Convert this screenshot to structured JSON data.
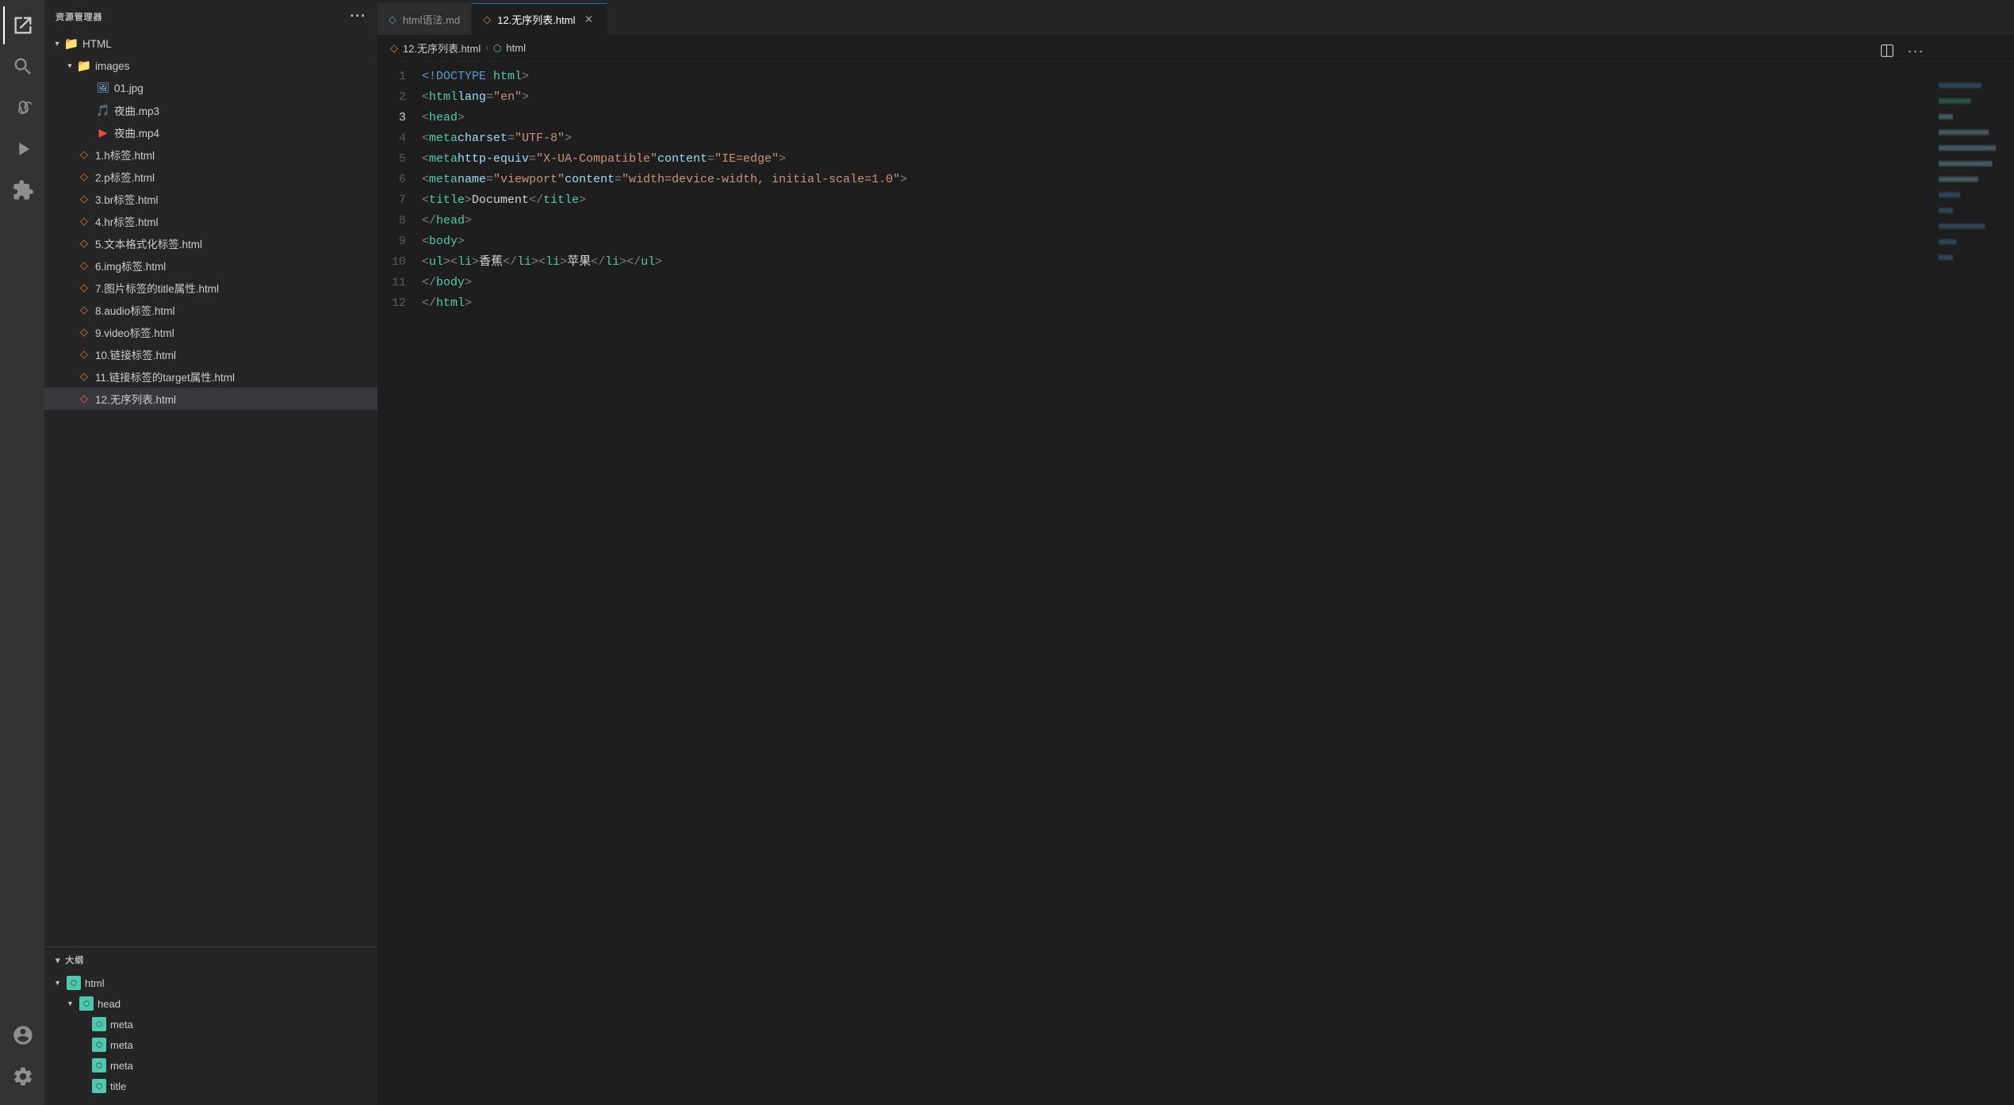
{
  "app": {
    "title": "资源管理器"
  },
  "tabs": [
    {
      "id": "tab-md",
      "icon": "◇",
      "icon_color": "#519aba",
      "label": "html语法.md",
      "active": false,
      "closable": false
    },
    {
      "id": "tab-html",
      "icon": "◇",
      "icon_color": "#e37933",
      "label": "12.无序列表.html",
      "active": true,
      "closable": true
    }
  ],
  "breadcrumb": {
    "parts": [
      "12.无序列表.html",
      ">",
      "html"
    ]
  },
  "sidebar": {
    "explorer_label": "资源管理器",
    "root_folder": "HTML",
    "tree": [
      {
        "id": "images",
        "type": "folder",
        "label": "images",
        "level": 1,
        "expanded": true
      },
      {
        "id": "01jpg",
        "type": "image",
        "label": "01.jpg",
        "level": 2
      },
      {
        "id": "yecmp3",
        "type": "audio",
        "label": "夜曲.mp3",
        "level": 2
      },
      {
        "id": "yecmp4",
        "type": "video",
        "label": "夜曲.mp4",
        "level": 2
      },
      {
        "id": "f1",
        "type": "html",
        "label": "1.h标签.html",
        "level": 1
      },
      {
        "id": "f2",
        "type": "html",
        "label": "2.p标签.html",
        "level": 1
      },
      {
        "id": "f3",
        "type": "html",
        "label": "3.br标签.html",
        "level": 1
      },
      {
        "id": "f4",
        "type": "html",
        "label": "4.hr标签.html",
        "level": 1
      },
      {
        "id": "f5",
        "type": "html",
        "label": "5.文本格式化标签.html",
        "level": 1
      },
      {
        "id": "f6",
        "type": "html",
        "label": "6.img标签.html",
        "level": 1
      },
      {
        "id": "f7",
        "type": "html",
        "label": "7.图片标签的title属性.html",
        "level": 1
      },
      {
        "id": "f8",
        "type": "html",
        "label": "8.audio标签.html",
        "level": 1
      },
      {
        "id": "f9",
        "type": "html",
        "label": "9.video标签.html",
        "level": 1
      },
      {
        "id": "f10",
        "type": "html",
        "label": "10.链接标签.html",
        "level": 1
      },
      {
        "id": "f11",
        "type": "html",
        "label": "11.链接标签的target属性.html",
        "level": 1
      },
      {
        "id": "f12",
        "type": "html",
        "label": "12.无序列表.html",
        "level": 1,
        "active": true
      }
    ]
  },
  "outline": {
    "label": "大纲",
    "items": [
      {
        "id": "o-html",
        "label": "html",
        "level": 0,
        "expanded": true
      },
      {
        "id": "o-head",
        "label": "head",
        "level": 1,
        "expanded": true
      },
      {
        "id": "o-meta1",
        "label": "meta",
        "level": 2
      },
      {
        "id": "o-meta2",
        "label": "meta",
        "level": 2
      },
      {
        "id": "o-meta3",
        "label": "meta",
        "level": 2
      },
      {
        "id": "o-title",
        "label": "title",
        "level": 2
      }
    ]
  },
  "editor": {
    "filename": "12.无序列表.html",
    "lines": [
      {
        "num": 1,
        "tokens": [
          {
            "t": "<!DOCTYPE ",
            "c": "doctype-kw"
          },
          {
            "t": "html",
            "c": "tag-name"
          },
          {
            "t": ">",
            "c": "punct"
          }
        ]
      },
      {
        "num": 2,
        "tokens": [
          {
            "t": "<",
            "c": "punct"
          },
          {
            "t": "html",
            "c": "tag-name"
          },
          {
            "t": " ",
            "c": ""
          },
          {
            "t": "lang",
            "c": "attr-name"
          },
          {
            "t": "=",
            "c": "punct"
          },
          {
            "t": "\"en\"",
            "c": "attr-val"
          },
          {
            "t": ">",
            "c": "punct"
          }
        ]
      },
      {
        "num": 3,
        "tokens": [
          {
            "t": "<",
            "c": "punct"
          },
          {
            "t": "head",
            "c": "tag-name"
          },
          {
            "t": ">",
            "c": "punct"
          }
        ],
        "active": false
      },
      {
        "num": 4,
        "tokens": [
          {
            "t": "    ",
            "c": ""
          },
          {
            "t": "<",
            "c": "punct"
          },
          {
            "t": "meta",
            "c": "tag-name"
          },
          {
            "t": " ",
            "c": ""
          },
          {
            "t": "charset",
            "c": "attr-name"
          },
          {
            "t": "=",
            "c": "punct"
          },
          {
            "t": "\"UTF-8\"",
            "c": "attr-val"
          },
          {
            "t": ">",
            "c": "punct"
          }
        ]
      },
      {
        "num": 5,
        "tokens": [
          {
            "t": "    ",
            "c": ""
          },
          {
            "t": "<",
            "c": "punct"
          },
          {
            "t": "meta",
            "c": "tag-name"
          },
          {
            "t": " ",
            "c": ""
          },
          {
            "t": "http-equiv",
            "c": "attr-name"
          },
          {
            "t": "=",
            "c": "punct"
          },
          {
            "t": "\"X-UA-Compatible\"",
            "c": "attr-val"
          },
          {
            "t": " ",
            "c": ""
          },
          {
            "t": "content",
            "c": "attr-name"
          },
          {
            "t": "=",
            "c": "punct"
          },
          {
            "t": "\"IE=edge\"",
            "c": "attr-val"
          },
          {
            "t": ">",
            "c": "punct"
          }
        ]
      },
      {
        "num": 6,
        "tokens": [
          {
            "t": "    ",
            "c": ""
          },
          {
            "t": "<",
            "c": "punct"
          },
          {
            "t": "meta",
            "c": "tag-name"
          },
          {
            "t": " ",
            "c": ""
          },
          {
            "t": "name",
            "c": "attr-name"
          },
          {
            "t": "=",
            "c": "punct"
          },
          {
            "t": "\"viewport\"",
            "c": "attr-val"
          },
          {
            "t": " ",
            "c": ""
          },
          {
            "t": "content",
            "c": "attr-name"
          },
          {
            "t": "=",
            "c": "punct"
          },
          {
            "t": "\"width=device-width, initial-scale=1.0\"",
            "c": "attr-val"
          },
          {
            "t": ">",
            "c": "punct"
          }
        ]
      },
      {
        "num": 7,
        "tokens": [
          {
            "t": "    ",
            "c": ""
          },
          {
            "t": "<",
            "c": "punct"
          },
          {
            "t": "title",
            "c": "tag-name"
          },
          {
            "t": ">",
            "c": "punct"
          },
          {
            "t": "Document",
            "c": "text-content"
          },
          {
            "t": "</",
            "c": "punct"
          },
          {
            "t": "title",
            "c": "tag-name"
          },
          {
            "t": ">",
            "c": "punct"
          }
        ]
      },
      {
        "num": 8,
        "tokens": [
          {
            "t": "</",
            "c": "punct"
          },
          {
            "t": "head",
            "c": "tag-name"
          },
          {
            "t": ">",
            "c": "punct"
          }
        ]
      },
      {
        "num": 9,
        "tokens": [
          {
            "t": "<",
            "c": "punct"
          },
          {
            "t": "body",
            "c": "tag-name"
          },
          {
            "t": ">",
            "c": "punct"
          }
        ]
      },
      {
        "num": 10,
        "tokens": [
          {
            "t": "    ",
            "c": ""
          },
          {
            "t": "<",
            "c": "punct"
          },
          {
            "t": "ul",
            "c": "tag-name"
          },
          {
            "t": ">",
            "c": "punct"
          },
          {
            "t": "<",
            "c": "punct"
          },
          {
            "t": "li",
            "c": "tag-name"
          },
          {
            "t": ">",
            "c": "punct"
          },
          {
            "t": "香蕉",
            "c": "text-content"
          },
          {
            "t": "</",
            "c": "punct"
          },
          {
            "t": "li",
            "c": "tag-name"
          },
          {
            "t": ">",
            "c": "punct"
          },
          {
            "t": "<",
            "c": "punct"
          },
          {
            "t": "li",
            "c": "tag-name"
          },
          {
            "t": ">",
            "c": "punct"
          },
          {
            "t": "苹果",
            "c": "text-content"
          },
          {
            "t": "</",
            "c": "punct"
          },
          {
            "t": "li",
            "c": "tag-name"
          },
          {
            "t": ">",
            "c": "punct"
          },
          {
            "t": "</",
            "c": "punct"
          },
          {
            "t": "ul",
            "c": "tag-name"
          },
          {
            "t": ">",
            "c": "punct"
          }
        ]
      },
      {
        "num": 11,
        "tokens": [
          {
            "t": "</",
            "c": "punct"
          },
          {
            "t": "body",
            "c": "tag-name"
          },
          {
            "t": ">",
            "c": "punct"
          }
        ]
      },
      {
        "num": 12,
        "tokens": [
          {
            "t": "</",
            "c": "punct"
          },
          {
            "t": "html",
            "c": "tag-name"
          },
          {
            "t": ">",
            "c": "punct"
          }
        ]
      }
    ]
  },
  "activity_bar": {
    "items": [
      {
        "id": "explorer",
        "label": "资源管理器",
        "active": true
      },
      {
        "id": "search",
        "label": "搜索",
        "active": false
      },
      {
        "id": "source-control",
        "label": "源代码管理",
        "active": false
      },
      {
        "id": "run",
        "label": "运行和调试",
        "active": false
      },
      {
        "id": "extensions",
        "label": "扩展",
        "active": false
      }
    ],
    "bottom_items": [
      {
        "id": "accounts",
        "label": "账户"
      },
      {
        "id": "settings",
        "label": "设置"
      }
    ]
  }
}
